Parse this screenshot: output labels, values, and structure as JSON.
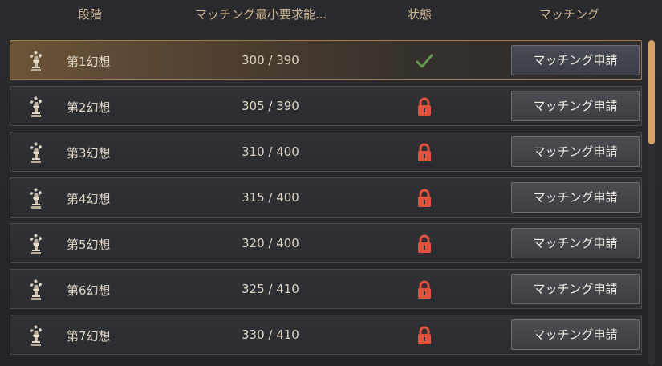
{
  "header": {
    "col_stage": "段階",
    "col_power": "マッチング最小要求能...",
    "col_status": "状態",
    "col_matching": "マッチング"
  },
  "rows": [
    {
      "name": "第1幻想",
      "power": "300 / 390",
      "status": "check-icon",
      "button": "マッチング申請",
      "selected": true
    },
    {
      "name": "第2幻想",
      "power": "305 / 390",
      "status": "lock-icon",
      "button": "マッチング申請",
      "selected": false
    },
    {
      "name": "第3幻想",
      "power": "310 / 400",
      "status": "lock-icon",
      "button": "マッチング申請",
      "selected": false
    },
    {
      "name": "第4幻想",
      "power": "315 / 400",
      "status": "lock-icon",
      "button": "マッチング申請",
      "selected": false
    },
    {
      "name": "第5幻想",
      "power": "320 / 400",
      "status": "lock-icon",
      "button": "マッチング申請",
      "selected": false
    },
    {
      "name": "第6幻想",
      "power": "325 / 410",
      "status": "lock-icon",
      "button": "マッチング申請",
      "selected": false
    },
    {
      "name": "第7幻想",
      "power": "330 / 410",
      "status": "lock-icon",
      "button": "マッチング申請",
      "selected": false
    }
  ],
  "colors": {
    "accent_gold": "#cdb58f",
    "check_green": "#5f9a4e",
    "lock_red": "#e0533f",
    "scroll_thumb": "#d7a266"
  },
  "icons": {
    "row_icon": "phantom-statue-icon",
    "unlocked": "check-icon",
    "locked": "lock-icon"
  }
}
